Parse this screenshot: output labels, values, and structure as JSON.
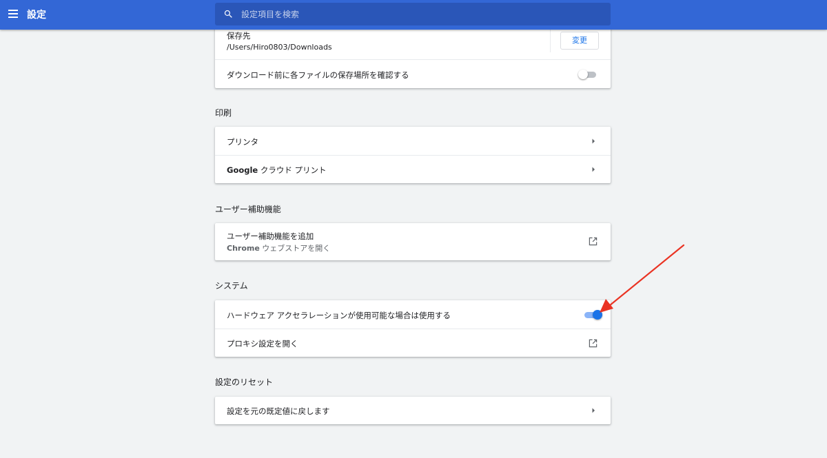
{
  "header": {
    "title": "設定",
    "search_placeholder": "設定項目を検索"
  },
  "downloads": {
    "save_location_label": "保存先",
    "save_location_path": "/Users/Hiro0803/Downloads",
    "change_button": "変更",
    "ask_location_label": "ダウンロード前に各ファイルの保存場所を確認する",
    "ask_location_enabled": false
  },
  "printing": {
    "section_title": "印刷",
    "items": [
      {
        "label": "プリンタ"
      },
      {
        "label_bold": "Google",
        "label": " クラウド プリント"
      }
    ]
  },
  "accessibility": {
    "section_title": "ユーザー補助機能",
    "add_label": "ユーザー補助機能を追加",
    "add_sub_bold": "Chrome",
    "add_sub": " ウェブストアを開く"
  },
  "system": {
    "section_title": "システム",
    "hardware_accel_label": "ハードウェア アクセラレーションが使用可能な場合は使用する",
    "hardware_accel_enabled": true,
    "proxy_label": "プロキシ設定を開く"
  },
  "reset": {
    "section_title": "設定のリセット",
    "restore_label": "設定を元の既定値に戻します"
  },
  "colors": {
    "header_bg": "#3367d6",
    "accent": "#1a73e8",
    "annotation_arrow": "#ea3323"
  },
  "icons": {
    "menu": "hamburger-menu-icon",
    "search": "search-icon",
    "chevron": "chevron-right-icon",
    "external": "open-in-new-icon",
    "annotation": "red-arrow-annotation"
  }
}
